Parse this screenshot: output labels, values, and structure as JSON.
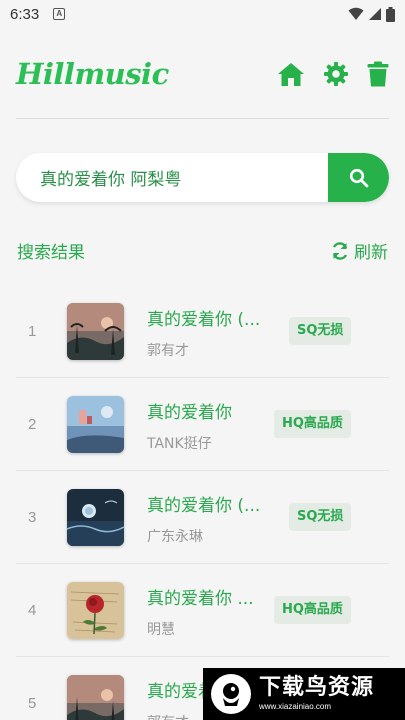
{
  "status_bar": {
    "time": "6:33",
    "notification_badge": "A",
    "icons": [
      "wifi-icon",
      "signal-icon",
      "battery-icon"
    ]
  },
  "header": {
    "logo": "Hillmusic",
    "icons": [
      "home-icon",
      "settings-icon",
      "trash-icon"
    ]
  },
  "search": {
    "value": "真的爱着你 阿梨粤",
    "button_icon": "search-icon"
  },
  "results": {
    "title": "搜索结果",
    "refresh_label": "刷新",
    "items": [
      {
        "index": "1",
        "title": "真的爱着你 (...",
        "artist": "郭有才",
        "quality": "SQ无损"
      },
      {
        "index": "2",
        "title": "真的爱着你",
        "artist": "TANK挺仔",
        "quality": "HQ高品质"
      },
      {
        "index": "3",
        "title": "真的爱着你 (...",
        "artist": "广东永琳",
        "quality": "SQ无损"
      },
      {
        "index": "4",
        "title": "真的爱着你 ...",
        "artist": "明慧",
        "quality": "HQ高品质"
      },
      {
        "index": "5",
        "title": "真的爱着你",
        "artist": "郭有才",
        "quality": ""
      }
    ]
  },
  "watermark": {
    "name": "下载鸟资源",
    "url": "www.xiazainiao.com"
  },
  "colors": {
    "accent": "#2aa94e",
    "search_button": "#27b14b",
    "badge_bg": "#e3ebe4"
  }
}
